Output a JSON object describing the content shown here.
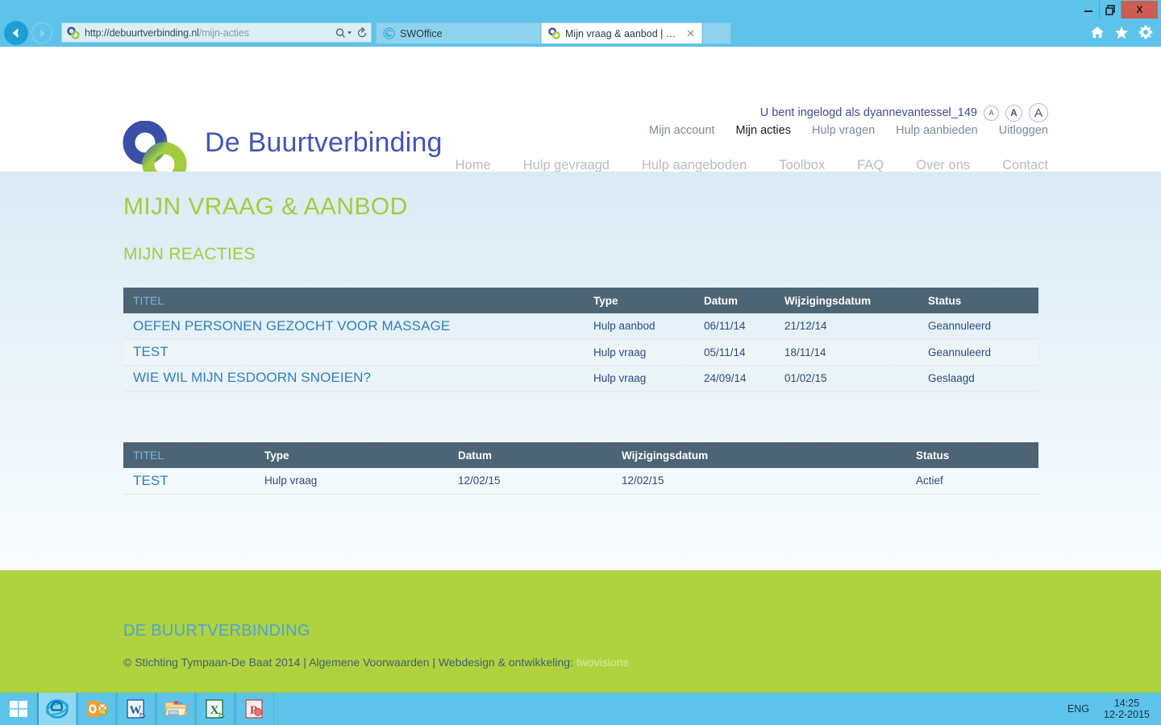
{
  "browser": {
    "window_buttons": {
      "minimize": "minimize-icon",
      "restore": "restore-icon",
      "close": "X"
    },
    "back_label": "back-arrow-icon",
    "forward_label": "forward-arrow-icon",
    "address": {
      "url_host": "http://debuurtverbinding.nl",
      "url_path": "/mijn-acties",
      "full_url": "http://debuurtverbinding.nl/mijn-acties",
      "search_icon": "search-icon",
      "refresh_icon": "refresh-icon"
    },
    "tabs": [
      {
        "title": "SWOffice",
        "active": false,
        "favicon": "swoffice-spiral-icon"
      },
      {
        "title": "Mijn vraag & aanbod | De B...",
        "active": true,
        "favicon": "site-logo-icon",
        "close": "✕"
      }
    ],
    "new_tab_label": "",
    "toolbar_icons": [
      "home-icon",
      "favorites-star-icon",
      "settings-gear-icon"
    ]
  },
  "site": {
    "brand": "De Buurtverbinding",
    "login_status": "U bent ingelogd als dyannevantessel_149",
    "fontsize_buttons": [
      {
        "label": "A",
        "size": "small"
      },
      {
        "label": "A",
        "size": "medium"
      },
      {
        "label": "A",
        "size": "large"
      }
    ],
    "user_nav": [
      {
        "label": "Mijn account",
        "active": false
      },
      {
        "label": "Mijn acties",
        "active": true
      },
      {
        "label": "Hulp vragen",
        "active": false
      },
      {
        "label": "Hulp aanbieden",
        "active": false
      },
      {
        "label": "Uitloggen",
        "active": false
      }
    ],
    "main_nav": [
      {
        "label": "Home"
      },
      {
        "label": "Hulp gevraagd"
      },
      {
        "label": "Hulp aangeboden"
      },
      {
        "label": "Toolbox"
      },
      {
        "label": "FAQ"
      },
      {
        "label": "Over ons"
      },
      {
        "label": "Contact"
      }
    ],
    "colors": {
      "brand_blue": "#4455b5",
      "accent_green": "#a3cd3e",
      "footer_green": "#afd23f",
      "table_header": "#4d6474",
      "link_blue": "#2f7fc4"
    }
  },
  "main": {
    "page_title": "MIJN VRAAG & AANBOD",
    "section_title": "MIJN REACTIES",
    "table_reacties": {
      "columns": [
        "TITEL",
        "Type",
        "Datum",
        "Wijzigingsdatum",
        "Status"
      ],
      "rows": [
        {
          "titel": "OEFEN PERSONEN GEZOCHT VOOR MASSAGE",
          "type": "Hulp aanbod",
          "datum": "06/11/14",
          "wijzigingsdatum": "21/12/14",
          "status": "Geannuleerd"
        },
        {
          "titel": "TEST",
          "type": "Hulp vraag",
          "datum": "05/11/14",
          "wijzigingsdatum": "18/11/14",
          "status": "Geannuleerd"
        },
        {
          "titel": "WIE WIL MIJN ESDOORN SNOEIEN?",
          "type": "Hulp vraag",
          "datum": "24/09/14",
          "wijzigingsdatum": "01/02/15",
          "status": "Geslaagd"
        }
      ]
    },
    "table_acties": {
      "columns": [
        "TITEL",
        "Type",
        "Datum",
        "Wijzigingsdatum",
        "Status"
      ],
      "rows": [
        {
          "titel": "TEST",
          "type": "Hulp vraag",
          "datum": "12/02/15",
          "wijzigingsdatum": "12/02/15",
          "status": "Actief"
        }
      ]
    }
  },
  "footer": {
    "title": "DE BUURTVERBINDING",
    "copyright": "© Stichting Tympaan-De Baat 2014",
    "separator": " | ",
    "terms": "Algemene Voorwaarden",
    "credit_label": "Webdesign & ontwikkeling",
    "credit_vendor": "twovisions"
  },
  "taskbar": {
    "items": [
      {
        "name": "start-button",
        "icon": "windows-logo-icon"
      },
      {
        "name": "internet-explorer",
        "icon": "ie-icon"
      },
      {
        "name": "outlook",
        "icon": "outlook-icon"
      },
      {
        "name": "word",
        "icon": "word-icon"
      },
      {
        "name": "file-explorer",
        "icon": "folder-icon"
      },
      {
        "name": "excel",
        "icon": "excel-icon"
      },
      {
        "name": "powerpoint",
        "icon": "powerpoint-icon"
      }
    ],
    "language": "ENG",
    "time": "14:25",
    "date": "12-2-2015"
  }
}
